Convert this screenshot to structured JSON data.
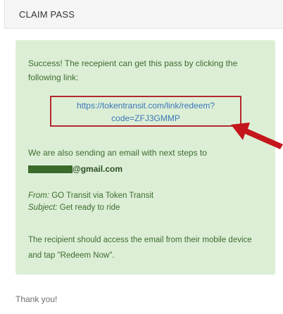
{
  "header": {
    "title": "CLAIM PASS"
  },
  "message": {
    "success_text": "Success! The recepient can get this pass by clicking the following link:",
    "link_line1": "https://tokentransit.com/link/redeem?",
    "link_line2": "code=ZFJ3GMMP",
    "email_intro": "We are also sending an email with next steps to",
    "email_domain": "@gmail.com",
    "from_label": "From:",
    "from_value": " GO Transit via Token Transit",
    "subject_label": "Subject:",
    "subject_value": " Get ready to ride",
    "access_text": "The recipient should access the email from their mobile device and tap \"Redeem Now\"."
  },
  "footer": {
    "thanks": "Thank you!"
  },
  "colors": {
    "success_bg": "#dcefd6",
    "success_text": "#3d6b2f",
    "link": "#3b75b8",
    "highlight": "#b5282f"
  },
  "annotations": {
    "arrow_icon": "red-arrow-icon"
  }
}
